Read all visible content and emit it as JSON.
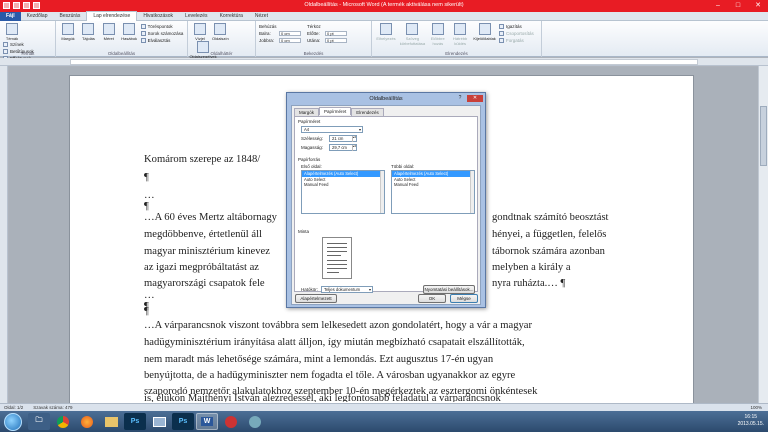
{
  "window": {
    "title": "Oldalbeállítás - Microsoft Word (A termék aktiválása nem sikerült)"
  },
  "ribbon_tabs": [
    "Fájl",
    "Kezdőlap",
    "Beszúrás",
    "Lap elrendezése",
    "Hivatkozások",
    "Levelezés",
    "Korrektúra",
    "Nézet"
  ],
  "ribbon": {
    "tema": {
      "buttons": [
        "Témák"
      ],
      "small": [
        "Színek",
        "Betűtípusok",
        "Effektusok"
      ],
      "label": "Témák"
    },
    "oldalbeallitas": {
      "buttons": [
        "Margók",
        "Tájolás",
        "Méret",
        "Hasábok"
      ],
      "small": [
        "Töréspontok",
        "Sorok számozása",
        "Elválasztás"
      ],
      "label": "Oldalbeállítás"
    },
    "oldalhatter": {
      "buttons": [
        "Vízjel",
        "Oldalszín",
        "Oldalszegélyek"
      ],
      "label": "Oldalháttér"
    },
    "bekezdes": {
      "behuzas": "Behúzás",
      "balra": "Balra:",
      "balra_val": "0 cm",
      "jobbra": "Jobbra:",
      "jobbra_val": "0 cm",
      "terkoz": "Térköz",
      "elotte": "Előtte:",
      "elotte_val": "0 pt",
      "utana": "Utána:",
      "utana_val": "0 pt",
      "label": "Bekezdés"
    },
    "elrendezes": {
      "buttons": [
        "Elhelyezés",
        "Szöveg körbefuttatása",
        "Előbbre hozás",
        "Hátrébb küldés",
        "Kijelölőablak"
      ],
      "small": [
        "Igazítás",
        "Csoportosítás",
        "Forgatás"
      ],
      "label": "Elrendezés"
    }
  },
  "document": {
    "lines": [
      "Komárom szerepe az 1848/",
      "¶",
      "…¶",
      "…A 60 éves Mertz altábornagy",
      "megdöbbenve, értetlenül áll",
      "magyar minisztérium kinevez",
      "az igazi megpróbáltatást az",
      "magyarországi csapatok fele",
      "…¶",
      "¶",
      "…A várparancsnok viszont továbbra sem lelkesedett azon gondolatért, hogy a vár a magyar",
      "hadügyminisztérium irányítása alatt álljon, így miután megbízható csapatait elszállították,",
      "nem maradt más lehetősége számára, mint a lemondás. Ezt augusztus 17-én ugyan",
      "benyújtotta, de a hadügyminiszter nem fogadta el tőle. A városban ugyanakkor az egyre",
      "szaporodó nemzetőr alakulatokhoz szeptember 10-én megérkeztek az esztergomi önkéntesek",
      "is, élükön Majthényi István alezredessel, aki legfontosabb feladatul a várparancsnok"
    ],
    "right_fragments": [
      "gondtnak számító beosztást",
      "hényei, a független, felelős",
      "tábornok számára azonban",
      "melyben a király a",
      "nyra ruházta.… ¶"
    ]
  },
  "status": {
    "page": "Oldal: 1/2",
    "words": "Szavak száma: 479",
    "zoom": "100%"
  },
  "taskbar": {
    "time": "16:15",
    "date": "2013.05.15."
  },
  "dialog": {
    "title": "Oldalbeállítás",
    "tabs": [
      "Margók",
      "Papírméret",
      "Elrendezés"
    ],
    "papirmeret_label": "Papírméret",
    "papirmeret_value": "A4",
    "szelesseg_label": "Szélesség:",
    "szelesseg_value": "21 cm",
    "magassag_label": "Magasság:",
    "magassag_value": "29,7 cm",
    "papirforras_label": "Papírforrás",
    "elso_oldal_label": "Első oldal:",
    "elso_oldal_items": [
      "Alapértelmezés (Auto Select)",
      "Auto Select",
      "Manual Feed"
    ],
    "tobbi_oldal_label": "Többi oldal:",
    "tobbi_oldal_items": [
      "Alapértelmezés (Auto Select)",
      "Auto Select",
      "Manual Feed"
    ],
    "minta_label": "Minta",
    "hatokor_label": "Hatókör:",
    "hatokor_value": "Teljes dokumentum",
    "nyomtatasi_button": "Nyomtatási beállítások...",
    "alapertelmezett_button": "Alapértelmezett",
    "ok_button": "OK",
    "megse_button": "Mégse"
  }
}
